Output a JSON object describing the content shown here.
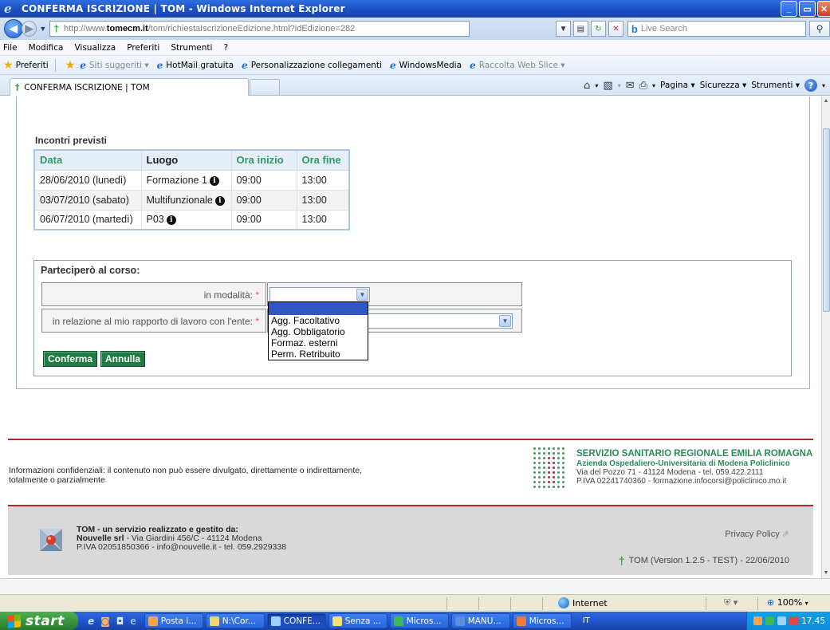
{
  "window": {
    "title": "CONFERMA ISCRIZIONE | TOM - Windows Internet Explorer",
    "btn_min": "_",
    "btn_max": "▭",
    "btn_close": "✕"
  },
  "address": {
    "url_prefix": "http://www.",
    "url_domain": "tomecm.it",
    "url_rest": "/tom/richiestaIscrizioneEdizione.html?idEdizione=282",
    "search_placeholder": "Live Search"
  },
  "menu": [
    "File",
    "Modifica",
    "Visualizza",
    "Preferiti",
    "Strumenti",
    "?"
  ],
  "favorites": {
    "label": "Preferiti",
    "items": [
      {
        "label": "Siti suggeriti ▾",
        "muted": true
      },
      {
        "label": "HotMail gratuita",
        "muted": false
      },
      {
        "label": "Personalizzazione collegamenti",
        "muted": false
      },
      {
        "label": "WindowsMedia",
        "muted": false
      },
      {
        "label": "Raccolta Web Slice ▾",
        "muted": true
      }
    ]
  },
  "tabs": {
    "active_label": "CONFERMA ISCRIZIONE | TOM",
    "commands": {
      "page": "Pagina ▾",
      "security": "Sicurezza ▾",
      "tools": "Strumenti ▾"
    }
  },
  "meetings": {
    "section_title": "Incontri previsti",
    "headers": {
      "date": "Data",
      "place": "Luogo",
      "start": "Ora inizio",
      "end": "Ora fine"
    },
    "rows": [
      {
        "date": "28/06/2010 (lunedì)",
        "place": "Formazione 1",
        "start": "09:00",
        "end": "13:00"
      },
      {
        "date": "03/07/2010 (sabato)",
        "place": "Multifunzionale",
        "start": "09:00",
        "end": "13:00"
      },
      {
        "date": "06/07/2010 (martedì)",
        "place": "P03",
        "start": "09:00",
        "end": "13:00"
      }
    ]
  },
  "form": {
    "title": "Parteciperò al corso:",
    "mode_label": "in modalità:",
    "relation_label": "in relazione al mio rapporto di lavoro con l'ente:",
    "required_mark": "*",
    "mode_value": "",
    "mode_options": [
      "",
      "Agg. Facoltativo",
      "Agg. Obbligatorio",
      "Formaz. esterni",
      "Perm. Retribuito"
    ],
    "confirm_label": "Conferma",
    "cancel_label": "Annulla"
  },
  "footer": {
    "confidential": "Informazioni confidenziali: il contenuto non può essere divulgato, direttamente o indirettamente, totalmente o parzialmente",
    "ssr_title": "SERVIZIO SANITARIO REGIONALE EMILIA ROMAGNA",
    "ssr_org": "Azienda Ospedaliero-Universitaria di Modena Policlinico",
    "ssr_address": "Via del Pozzo 71 - 41124 Modena - tel. 059.422.2111",
    "ssr_vat": "P.IVA 02241740360 - formazione.infocorsi@policlinico.mo.it",
    "tom_line1": "TOM - un servizio realizzato e gestito da:",
    "tom_company": "Nouvelle srl",
    "tom_address": " - Via Giardini 456/C - 41124 Modena",
    "tom_vat": "P.IVA 02051850366 - info@nouvelle.it - tel. 059.2929338",
    "privacy": "Privacy Policy",
    "version": "TOM (Version 1.2.5 - TEST) - 22/06/2010"
  },
  "status": {
    "zone": "Internet",
    "zoom": "100%"
  },
  "taskbar": {
    "start": "start",
    "tasks": [
      "Posta i...",
      "N:\\Cor...",
      "CONFE...",
      "Senza ...",
      "Micros...",
      "MANU...",
      "Micros..."
    ],
    "active_index": 2,
    "lang": "IT",
    "clock": "17.45"
  }
}
